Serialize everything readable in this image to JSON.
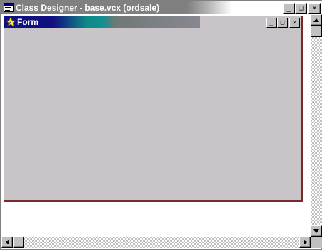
{
  "window": {
    "title": "Class Designer - base.vcx (ordsale)",
    "icon": "class-designer-icon",
    "controls": {
      "minimize": "_",
      "maximize": "□",
      "close": "✕"
    }
  },
  "form": {
    "title": "Form",
    "icon": "form-wizard-icon",
    "controls": {
      "minimize": "_",
      "maximize": "□",
      "close": "✕"
    }
  },
  "scrollbars": {
    "vertical": {
      "up": "up-arrow-icon",
      "down": "down-arrow-icon"
    },
    "horizontal": {
      "left": "left-arrow-icon",
      "right": "right-arrow-icon"
    }
  },
  "colors": {
    "form_canvas": "#c8c4c8",
    "active_title": "#101080",
    "inactive_title": "#808080"
  }
}
